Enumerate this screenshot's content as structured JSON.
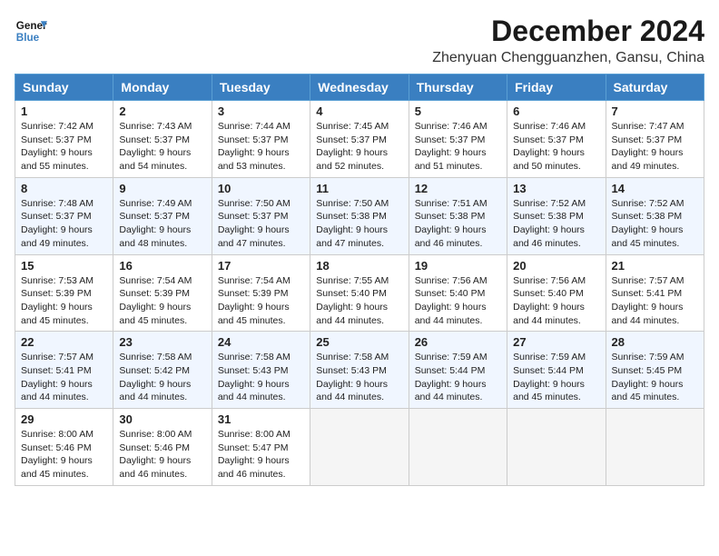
{
  "logo": {
    "line1": "General",
    "line2": "Blue"
  },
  "title": "December 2024",
  "location": "Zhenyuan Chengguanzhen, Gansu, China",
  "columns": [
    "Sunday",
    "Monday",
    "Tuesday",
    "Wednesday",
    "Thursday",
    "Friday",
    "Saturday"
  ],
  "weeks": [
    [
      {
        "day": "1",
        "sunrise": "Sunrise: 7:42 AM",
        "sunset": "Sunset: 5:37 PM",
        "daylight": "Daylight: 9 hours and 55 minutes."
      },
      {
        "day": "2",
        "sunrise": "Sunrise: 7:43 AM",
        "sunset": "Sunset: 5:37 PM",
        "daylight": "Daylight: 9 hours and 54 minutes."
      },
      {
        "day": "3",
        "sunrise": "Sunrise: 7:44 AM",
        "sunset": "Sunset: 5:37 PM",
        "daylight": "Daylight: 9 hours and 53 minutes."
      },
      {
        "day": "4",
        "sunrise": "Sunrise: 7:45 AM",
        "sunset": "Sunset: 5:37 PM",
        "daylight": "Daylight: 9 hours and 52 minutes."
      },
      {
        "day": "5",
        "sunrise": "Sunrise: 7:46 AM",
        "sunset": "Sunset: 5:37 PM",
        "daylight": "Daylight: 9 hours and 51 minutes."
      },
      {
        "day": "6",
        "sunrise": "Sunrise: 7:46 AM",
        "sunset": "Sunset: 5:37 PM",
        "daylight": "Daylight: 9 hours and 50 minutes."
      },
      {
        "day": "7",
        "sunrise": "Sunrise: 7:47 AM",
        "sunset": "Sunset: 5:37 PM",
        "daylight": "Daylight: 9 hours and 49 minutes."
      }
    ],
    [
      {
        "day": "8",
        "sunrise": "Sunrise: 7:48 AM",
        "sunset": "Sunset: 5:37 PM",
        "daylight": "Daylight: 9 hours and 49 minutes."
      },
      {
        "day": "9",
        "sunrise": "Sunrise: 7:49 AM",
        "sunset": "Sunset: 5:37 PM",
        "daylight": "Daylight: 9 hours and 48 minutes."
      },
      {
        "day": "10",
        "sunrise": "Sunrise: 7:50 AM",
        "sunset": "Sunset: 5:37 PM",
        "daylight": "Daylight: 9 hours and 47 minutes."
      },
      {
        "day": "11",
        "sunrise": "Sunrise: 7:50 AM",
        "sunset": "Sunset: 5:38 PM",
        "daylight": "Daylight: 9 hours and 47 minutes."
      },
      {
        "day": "12",
        "sunrise": "Sunrise: 7:51 AM",
        "sunset": "Sunset: 5:38 PM",
        "daylight": "Daylight: 9 hours and 46 minutes."
      },
      {
        "day": "13",
        "sunrise": "Sunrise: 7:52 AM",
        "sunset": "Sunset: 5:38 PM",
        "daylight": "Daylight: 9 hours and 46 minutes."
      },
      {
        "day": "14",
        "sunrise": "Sunrise: 7:52 AM",
        "sunset": "Sunset: 5:38 PM",
        "daylight": "Daylight: 9 hours and 45 minutes."
      }
    ],
    [
      {
        "day": "15",
        "sunrise": "Sunrise: 7:53 AM",
        "sunset": "Sunset: 5:39 PM",
        "daylight": "Daylight: 9 hours and 45 minutes."
      },
      {
        "day": "16",
        "sunrise": "Sunrise: 7:54 AM",
        "sunset": "Sunset: 5:39 PM",
        "daylight": "Daylight: 9 hours and 45 minutes."
      },
      {
        "day": "17",
        "sunrise": "Sunrise: 7:54 AM",
        "sunset": "Sunset: 5:39 PM",
        "daylight": "Daylight: 9 hours and 45 minutes."
      },
      {
        "day": "18",
        "sunrise": "Sunrise: 7:55 AM",
        "sunset": "Sunset: 5:40 PM",
        "daylight": "Daylight: 9 hours and 44 minutes."
      },
      {
        "day": "19",
        "sunrise": "Sunrise: 7:56 AM",
        "sunset": "Sunset: 5:40 PM",
        "daylight": "Daylight: 9 hours and 44 minutes."
      },
      {
        "day": "20",
        "sunrise": "Sunrise: 7:56 AM",
        "sunset": "Sunset: 5:40 PM",
        "daylight": "Daylight: 9 hours and 44 minutes."
      },
      {
        "day": "21",
        "sunrise": "Sunrise: 7:57 AM",
        "sunset": "Sunset: 5:41 PM",
        "daylight": "Daylight: 9 hours and 44 minutes."
      }
    ],
    [
      {
        "day": "22",
        "sunrise": "Sunrise: 7:57 AM",
        "sunset": "Sunset: 5:41 PM",
        "daylight": "Daylight: 9 hours and 44 minutes."
      },
      {
        "day": "23",
        "sunrise": "Sunrise: 7:58 AM",
        "sunset": "Sunset: 5:42 PM",
        "daylight": "Daylight: 9 hours and 44 minutes."
      },
      {
        "day": "24",
        "sunrise": "Sunrise: 7:58 AM",
        "sunset": "Sunset: 5:43 PM",
        "daylight": "Daylight: 9 hours and 44 minutes."
      },
      {
        "day": "25",
        "sunrise": "Sunrise: 7:58 AM",
        "sunset": "Sunset: 5:43 PM",
        "daylight": "Daylight: 9 hours and 44 minutes."
      },
      {
        "day": "26",
        "sunrise": "Sunrise: 7:59 AM",
        "sunset": "Sunset: 5:44 PM",
        "daylight": "Daylight: 9 hours and 44 minutes."
      },
      {
        "day": "27",
        "sunrise": "Sunrise: 7:59 AM",
        "sunset": "Sunset: 5:44 PM",
        "daylight": "Daylight: 9 hours and 45 minutes."
      },
      {
        "day": "28",
        "sunrise": "Sunrise: 7:59 AM",
        "sunset": "Sunset: 5:45 PM",
        "daylight": "Daylight: 9 hours and 45 minutes."
      }
    ],
    [
      {
        "day": "29",
        "sunrise": "Sunrise: 8:00 AM",
        "sunset": "Sunset: 5:46 PM",
        "daylight": "Daylight: 9 hours and 45 minutes."
      },
      {
        "day": "30",
        "sunrise": "Sunrise: 8:00 AM",
        "sunset": "Sunset: 5:46 PM",
        "daylight": "Daylight: 9 hours and 46 minutes."
      },
      {
        "day": "31",
        "sunrise": "Sunrise: 8:00 AM",
        "sunset": "Sunset: 5:47 PM",
        "daylight": "Daylight: 9 hours and 46 minutes."
      },
      null,
      null,
      null,
      null
    ]
  ]
}
